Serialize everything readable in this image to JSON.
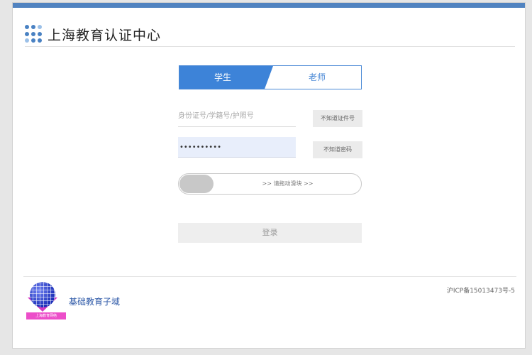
{
  "header": {
    "title": "上海教育认证中心"
  },
  "tabs": [
    {
      "label": "学生",
      "active": true
    },
    {
      "label": "老师",
      "active": false
    }
  ],
  "form": {
    "id_placeholder": "身份证号/学籍号/护照号",
    "password_value": "••••••••••",
    "forgot_id_label": "不知道证件号",
    "forgot_password_label": "不知道密码",
    "slider_label": ">> 请拖动滑块 >>",
    "login_label": "登录"
  },
  "footer": {
    "site_name": "基础教育子域",
    "logo_badge": "上海教育网络",
    "icp": "沪ICP备15013473号-5"
  },
  "colors": {
    "accent": "#3d83d8",
    "top_bar": "#5183c0"
  }
}
